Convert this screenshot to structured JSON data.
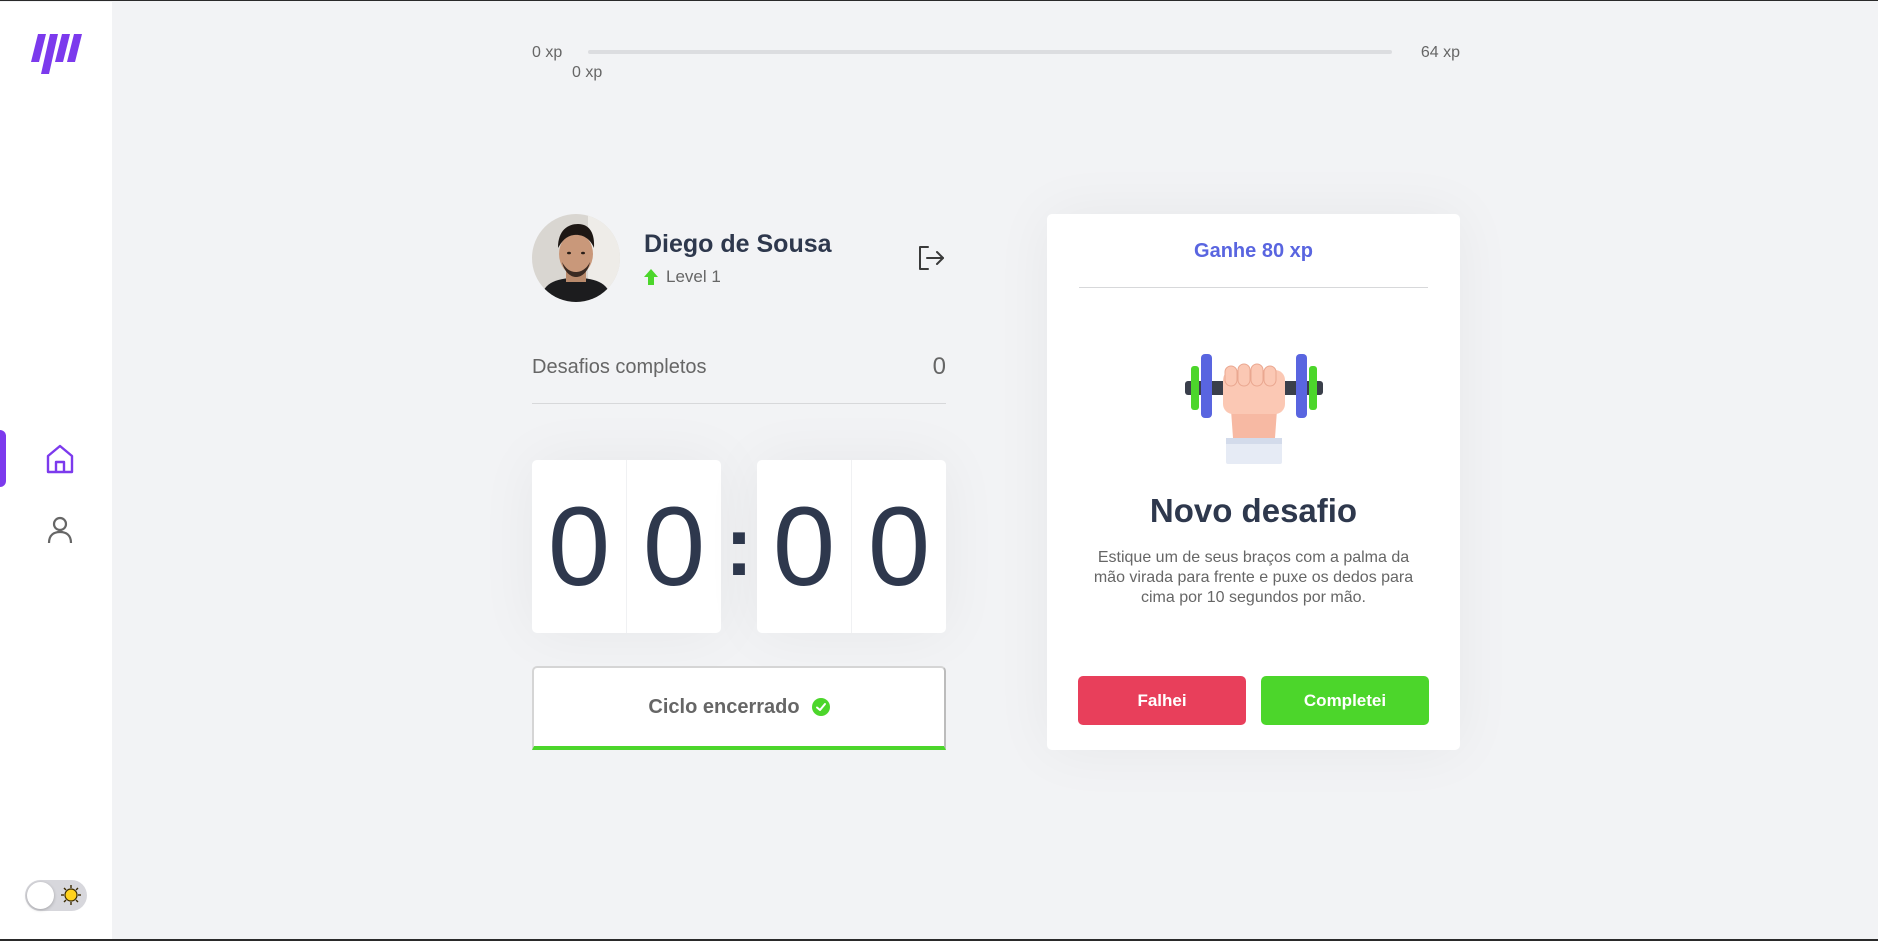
{
  "xp": {
    "min_label": "0 xp",
    "max_label": "64 xp",
    "current_label": "0 xp",
    "progress_fraction": 0.0
  },
  "profile": {
    "name": "Diego de Sousa",
    "level_label": "Level 1"
  },
  "challenges": {
    "label": "Desafios completos",
    "count": "0"
  },
  "countdown": {
    "min_left": "0",
    "min_right": "0",
    "separator": ":",
    "sec_left": "0",
    "sec_right": "0"
  },
  "cycle_button": {
    "label": "Ciclo encerrado"
  },
  "challenge_card": {
    "reward": "Ganhe 80 xp",
    "title": "Novo desafio",
    "description": "Estique um de seus braços com a palma da mão virada para frente e puxe os dedos para cima por 10 segundos por mão.",
    "fail_label": "Falhei",
    "complete_label": "Completei"
  },
  "icons": {
    "logo": "logo-icon",
    "home": "home-icon",
    "user": "user-icon",
    "logout": "logout-icon",
    "level": "arrow-up-icon",
    "check": "check-circle-icon",
    "theme": "sun-icon"
  },
  "colors": {
    "accent": "#5965e0",
    "brand_purple": "#7c3aed",
    "success": "#4cd62b",
    "danger": "#e83f5b"
  }
}
